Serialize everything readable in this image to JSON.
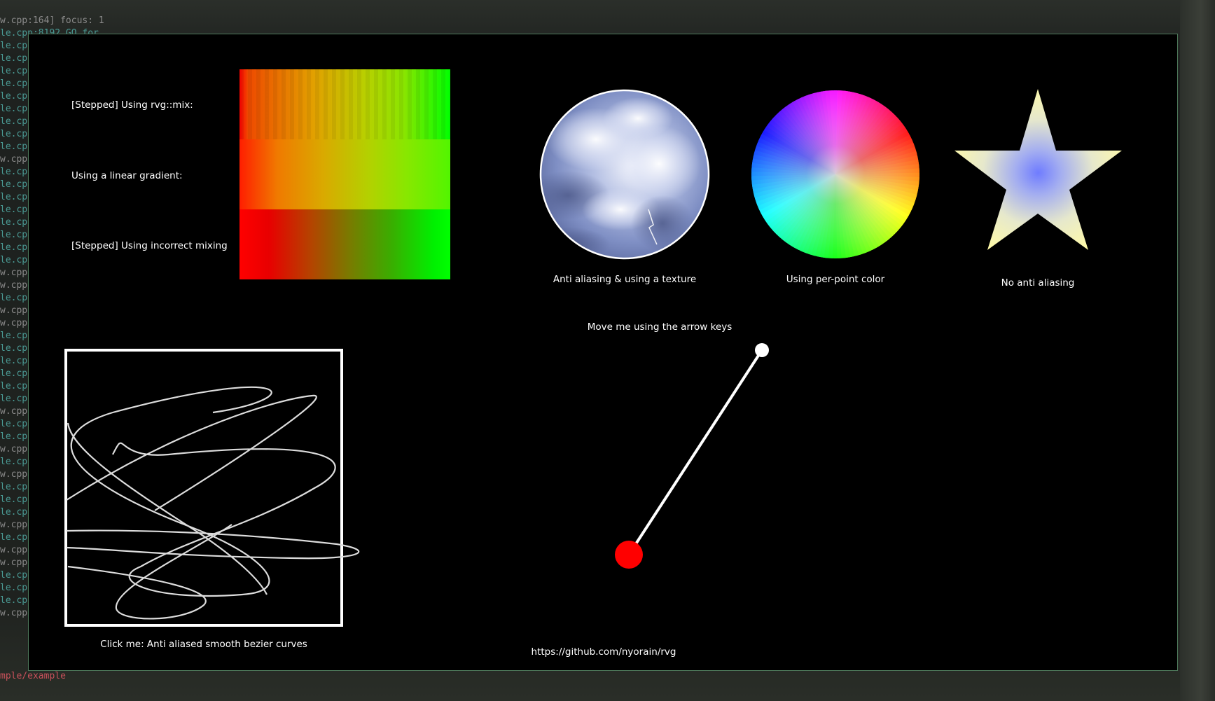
{
  "terminal": {
    "header_line": "w.cpp:164] focus: 1",
    "header_line_2": "le.cpp:8192 GO for",
    "file_fragments": {
      "le": "le.cp",
      "w": "w.cpp"
    },
    "prompt_fragment": "mple/example"
  },
  "app": {
    "labels": {
      "stepped_mix": "[Stepped] Using rvg::mix:",
      "linear_gradient": "Using a linear gradient:",
      "stepped_incorrect": "[Stepped] Using incorrect mixing",
      "texture_circle": "Anti aliasing & using a texture",
      "per_point_color": "Using per-point color",
      "no_anti_aliasing": "No anti aliasing",
      "move_hint": "Move me using the arrow keys",
      "bezier_hint": "Click me: Anti aliased smooth bezier curves",
      "url": "https://github.com/nyorain/rvg"
    },
    "colors": {
      "window_border": "#4f7a5c",
      "background": "#000000",
      "handle_red": "#ff0000",
      "handle_white": "#ffffff",
      "star_edge": "#fffaa8",
      "star_center": "#6f7cff"
    },
    "icons": {
      "star": "star-shape",
      "texture_circle": "textured-circle",
      "color_wheel": "color-wheel"
    }
  }
}
